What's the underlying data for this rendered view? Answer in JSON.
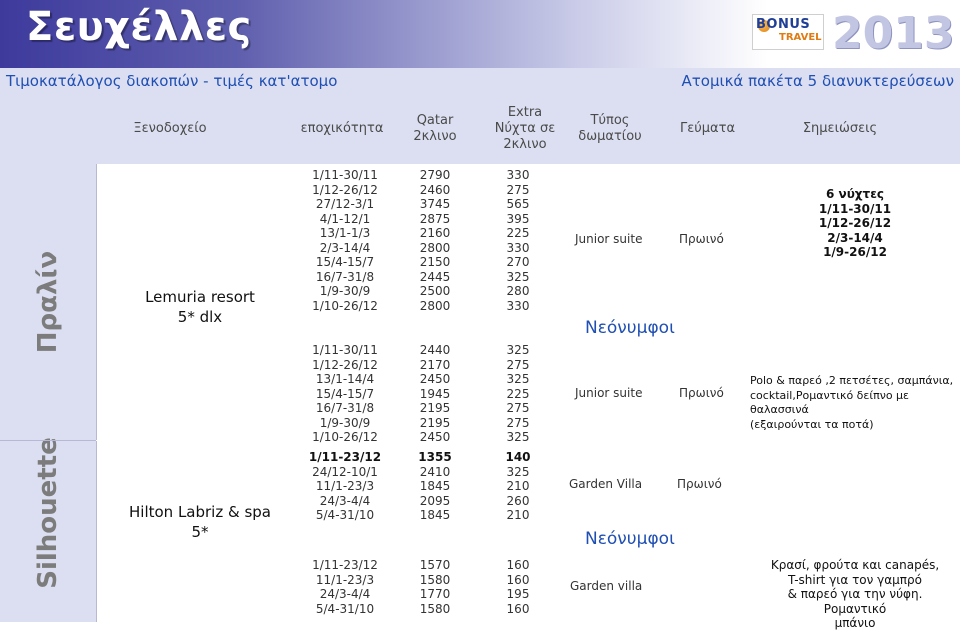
{
  "banner": {
    "title": "Σευχέλλες",
    "logo_bonus": "BONUS",
    "logo_travel": "TRAVEL",
    "year": "2013"
  },
  "subbar": {
    "left": "Τιμοκατάλογος διακοπών  - τιμές κατ'ατομο",
    "right": "Ατομικά πακέτα 5 διανυκτερεύσεων"
  },
  "headers": {
    "hotel": "Ξενοδοχείο",
    "season": "εποχικότητα",
    "qatar": "Qatar\n2κλινο",
    "extra": "Extra\nΝύχτα σε\n2κλινο",
    "room_type": "Τύπος\nδωματίου",
    "meals": "Γεύματα",
    "notes": "Σημειώσεις"
  },
  "sections": [
    {
      "label": "Πραλίν",
      "hotel_line1": "Lemuria resort",
      "hotel_line2": "5* dlx",
      "groups": [
        {
          "seasons": "1/11-30/11\n1/12-26/12\n27/12-3/1\n4/1-12/1\n13/1-1/3\n2/3-14/4\n15/4-15/7\n16/7-31/8\n1/9-30/9\n1/10-26/12",
          "qatar": "2790\n2460\n3745\n2875\n2160\n2800\n2150\n2445\n2500\n2800",
          "extra": "330\n275\n565\n395\n225\n330\n270\n325\n280\n330",
          "room": "Junior suite",
          "meal": "Πρωινό",
          "note": "6 νύχτες\n1/11-30/11\n1/12-26/12\n2/3-14/4\n1/9-26/12"
        },
        {
          "caption": "Νεόνυμφοι",
          "seasons": "1/11-30/11\n1/12-26/12\n13/1-14/4\n15/4-15/7\n16/7-31/8\n1/9-30/9\n1/10-26/12",
          "qatar": "2440\n2170\n2450\n1945\n2195\n2195\n2450",
          "extra": "325\n275\n325\n225\n275\n275\n325",
          "room": "Junior suite",
          "meal": "Πρωινό",
          "note": "Polo & παρεό ,2 πετσέτες, σαμπάνια,\ncocktail,Ρομαντικό δείπνο με θαλασσινά\n(εξαιρούνται τα ποτά)"
        }
      ]
    },
    {
      "label": "Silhouette",
      "hotel_line1": "Hilton Labriz & spa",
      "hotel_line2": "5*",
      "groups": [
        {
          "seasons_first": "1/11-23/12",
          "seasons": "24/12-10/1\n11/1-23/3\n24/3-4/4\n5/4-31/10",
          "qatar_first": "1355",
          "qatar": "2410\n1845\n2095\n1845",
          "extra_first": "140",
          "extra": "325\n210\n260\n210",
          "room": "Garden Villa",
          "meal": "Πρωινό"
        },
        {
          "caption": "Νεόνυμφοι",
          "seasons": "1/11-23/12\n11/1-23/3\n24/3-4/4\n5/4-31/10",
          "qatar": "1570\n1580\n1770\n1580",
          "extra": "160\n160\n195\n160",
          "room": "Garden villa",
          "note": "Κρασί, φρούτα και canapés,\nT-shirt για τον γαμπρό\n& παρεό για την νύφη. Ρομαντικό\nμπάνιο"
        }
      ]
    }
  ]
}
